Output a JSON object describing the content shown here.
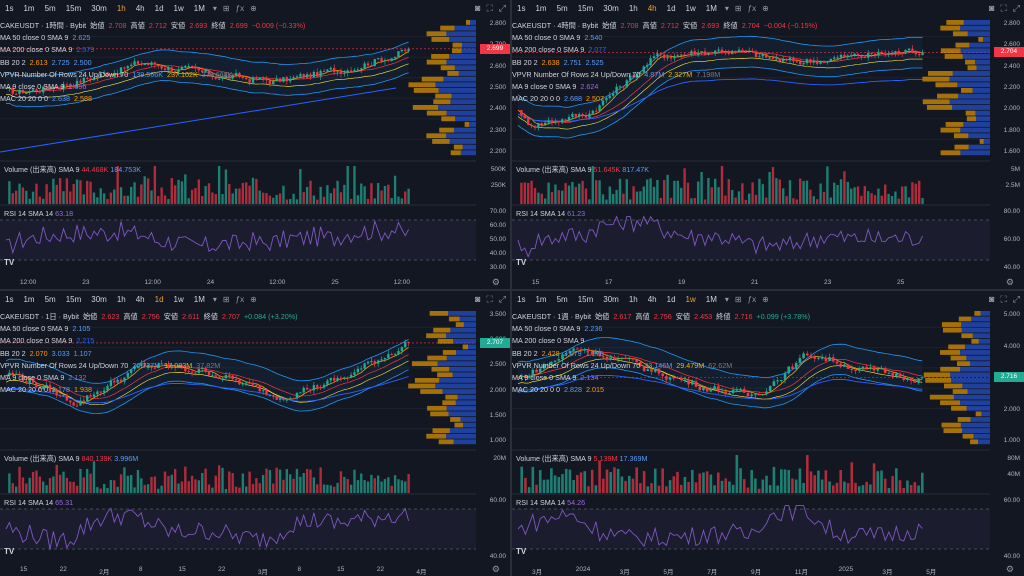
{
  "toolbar": {
    "intervals": [
      "1s",
      "1m",
      "5m",
      "15m",
      "30m",
      "1h",
      "4h",
      "1d",
      "1w",
      "1M"
    ],
    "tools": [
      "⊞",
      "ƒx",
      "⊕"
    ]
  },
  "panes": [
    {
      "id": "p1",
      "active": "1h",
      "title": "CAKEUSDT · 1時間 · Bybit",
      "ohlc": {
        "o_label": "始値",
        "o": "2.708",
        "h_label": "高値",
        "h": "2.712",
        "l_label": "安値",
        "l": "2.693",
        "c_label": "終値",
        "c": "2.699",
        "chg": "−0.009 (−0.33%)"
      },
      "ma50": {
        "label": "MA 50 close 0 SMA 9",
        "v": "2.625"
      },
      "ma200": {
        "label": "MA 200 close 0 SMA 9",
        "v": "2.579"
      },
      "bb": {
        "label": "BB 20 2",
        "v1": "2.613",
        "v2": "2.725",
        "v3": "2.500"
      },
      "vpvr": {
        "label": "VPVR Number Of Rows 24 Up/Down 70",
        "v1": "139.566K",
        "v2": "237.102K",
        "v3": "376.668K"
      },
      "ma9": {
        "label": "MA 9 close 0 SMA 9",
        "v": "2.656"
      },
      "mac": {
        "label": "MAC 20 20 0 0",
        "v1": "2.638",
        "v2": "2.588"
      },
      "volume": {
        "label": "Volume (出来高) SMA 9",
        "v1": "44.468K",
        "v2": "184.753K"
      },
      "rsi": {
        "label": "RSI 14 SMA 14",
        "v": "63.18"
      },
      "price_tag": "2.699",
      "yaxis": [
        "2.800",
        "2.700",
        "2.600",
        "2.500",
        "2.400",
        "2.300",
        "2.200"
      ],
      "vol_axis": [
        "500K",
        "250K"
      ],
      "rsi_axis": [
        "70.00",
        "60.00",
        "50.00",
        "40.00",
        "30.00"
      ],
      "xaxis": [
        "12:00",
        "23",
        "12:00",
        "24",
        "12:00",
        "25",
        "12:00"
      ]
    },
    {
      "id": "p2",
      "active": "4h",
      "title": "CAKEUSDT · 4時間 · Bybit",
      "ohlc": {
        "o_label": "始値",
        "o": "2.708",
        "h_label": "高値",
        "h": "2.712",
        "l_label": "安値",
        "l": "2.693",
        "c_label": "終値",
        "c": "2.704",
        "chg": "−0.004 (−0.15%)"
      },
      "ma50": {
        "label": "MA 50 close 0 SMA 9",
        "v": "2.540"
      },
      "ma200": {
        "label": "MA 200 close 0 SMA 9",
        "v": "2.077"
      },
      "bb": {
        "label": "BB 20 2",
        "v1": "2.638",
        "v2": "2.751",
        "v3": "2.525"
      },
      "vpvr": {
        "label": "VPVR Number Of Rows 24 Up/Down 70",
        "v1": "4.87M",
        "v2": "2.327M",
        "v3": "7.198M"
      },
      "ma9": {
        "label": "MA 9 close 0 SMA 9",
        "v": "2.624"
      },
      "mac": {
        "label": "MAC 20 20 0 0",
        "v1": "2.688",
        "v2": "2.507"
      },
      "volume": {
        "label": "Volume (出来高) SMA 9",
        "v1": "51.645K",
        "v2": "817.47K"
      },
      "rsi": {
        "label": "RSI 14 SMA 14",
        "v": "61.23"
      },
      "price_tag": "2.704",
      "yaxis": [
        "2.800",
        "2.600",
        "2.400",
        "2.200",
        "2.000",
        "1.800",
        "1.600"
      ],
      "vol_axis": [
        "5M",
        "2.5M"
      ],
      "rsi_axis": [
        "80.00",
        "60.00",
        "40.00"
      ],
      "xaxis": [
        "15",
        "17",
        "19",
        "21",
        "23",
        "25"
      ]
    },
    {
      "id": "p3",
      "active": "1d",
      "title": "CAKEUSDT · 1日 · Bybit",
      "ohlc": {
        "o_label": "始値",
        "o": "2.623",
        "h_label": "高値",
        "h": "2.756",
        "l_label": "安値",
        "l": "2.611",
        "c_label": "終値",
        "c": "2.707",
        "chg": "+0.084 (+3.20%)"
      },
      "ma50": {
        "label": "MA 50 close 0 SMA 9",
        "v": "2.105"
      },
      "ma200": {
        "label": "MA 200 close 0 SMA 9",
        "v": "2.215"
      },
      "bb": {
        "label": "BB 20 2",
        "v1": "2.070",
        "v2": "3.033",
        "v3": "1.107"
      },
      "vpvr": {
        "label": "VPVR Number Of Rows 24 Up/Down 70",
        "v1": "20.737M",
        "v2": "17.083M",
        "v3": "37.82M"
      },
      "ma9": {
        "label": "MA 9 close 0 SMA 9",
        "v": "2.132"
      },
      "mac": {
        "label": "MAC 20 20 0 0",
        "v1": "2.178",
        "v2": "1.938"
      },
      "volume": {
        "label": "Volume (出来高) SMA 9",
        "v1": "840.139K",
        "v2": "3.996M"
      },
      "rsi": {
        "label": "RSI 14 SMA 14",
        "v": "65.31"
      },
      "price_tag": "2.707",
      "yaxis": [
        "3.500",
        "3.000",
        "2.500",
        "2.000",
        "1.500",
        "1.000"
      ],
      "vol_axis": [
        "20M"
      ],
      "rsi_axis": [
        "60.00",
        "40.00"
      ],
      "xaxis": [
        "15",
        "22",
        "2月",
        "8",
        "15",
        "22",
        "3月",
        "8",
        "15",
        "22",
        "4月"
      ]
    },
    {
      "id": "p4",
      "active": "1w",
      "title": "CAKEUSDT · 1週 · Bybit",
      "ohlc": {
        "o_label": "始値",
        "o": "2.617",
        "h_label": "高値",
        "h": "2.756",
        "l_label": "安値",
        "l": "2.453",
        "c_label": "終値",
        "c": "2.716",
        "chg": "+0.099 (+3.78%)"
      },
      "ma50": {
        "label": "MA 50 close 0 SMA 9",
        "v": "2.236"
      },
      "ma200": {
        "label": "MA 200 close 0 SMA 9",
        "v": ""
      },
      "bb": {
        "label": "BB 20 2",
        "v1": "2.428",
        "v2": "3.679",
        "v3": "1.176"
      },
      "vpvr": {
        "label": "VPVR Number Of Rows 24 Up/Down 70",
        "v1": "33.146M",
        "v2": "29.479M",
        "v3": "62.62M"
      },
      "ma9": {
        "label": "MA 9 close 0 SMA 9",
        "v": "2.134"
      },
      "mac": {
        "label": "MAC 20 20 0 0",
        "v1": "2.828",
        "v2": "2.015"
      },
      "volume": {
        "label": "Volume (出来高) SMA 9",
        "v1": "5.139M",
        "v2": "17.369M"
      },
      "rsi": {
        "label": "RSI 14 SMA 14",
        "v": "54.26"
      },
      "price_tag": "2.716",
      "yaxis": [
        "5.000",
        "4.000",
        "3.000",
        "2.000",
        "1.000"
      ],
      "vol_axis": [
        "80M",
        "40M"
      ],
      "rsi_axis": [
        "60.00",
        "40.00"
      ],
      "xaxis": [
        "3月",
        "2024",
        "3月",
        "5月",
        "7月",
        "9月",
        "11月",
        "2025",
        "3月",
        "5月"
      ]
    }
  ],
  "colors": {
    "up": "#22ab94",
    "down": "#f23645",
    "bb": "#2962ff",
    "ma9": "#ff9800",
    "ma200": "#2962ff",
    "rsi": "#7e57c2",
    "bg": "#131722"
  }
}
